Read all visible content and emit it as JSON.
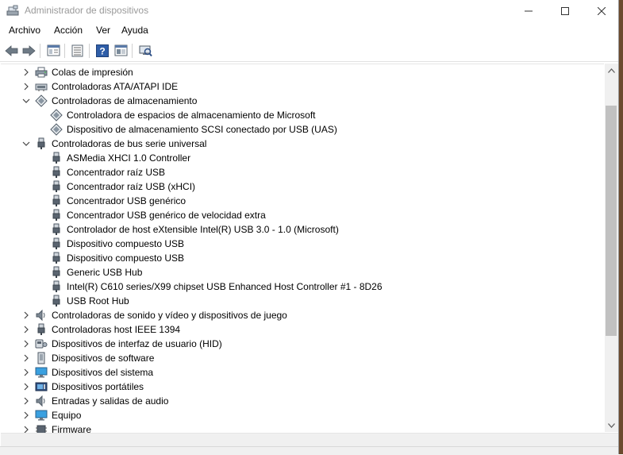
{
  "window": {
    "title": "Administrador de dispositivos"
  },
  "menu": [
    "Archivo",
    "Acción",
    "Ver",
    "Ayuda"
  ],
  "toolbar": [
    {
      "icon": "back-arrow-icon"
    },
    {
      "icon": "forward-arrow-icon"
    },
    {
      "icon": "properties-icon"
    },
    {
      "icon": "list-view-icon"
    },
    {
      "icon": "help-icon"
    },
    {
      "icon": "action-icon"
    },
    {
      "icon": "scan-hardware-icon"
    }
  ],
  "tree": [
    {
      "label": "Colas de impresión",
      "level": 0,
      "expander": "collapsed",
      "icon": "printer-icon"
    },
    {
      "label": "Controladoras ATA/ATAPI IDE",
      "level": 0,
      "expander": "collapsed",
      "icon": "ide-controller-icon"
    },
    {
      "label": "Controladoras de almacenamiento",
      "level": 0,
      "expander": "expanded",
      "icon": "storage-controller-icon"
    },
    {
      "label": "Controladora de espacios de almacenamiento de Microsoft",
      "level": 1,
      "expander": "none",
      "icon": "storage-controller-icon"
    },
    {
      "label": "Dispositivo de almacenamiento SCSI conectado por USB (UAS)",
      "level": 1,
      "expander": "none",
      "icon": "storage-controller-icon"
    },
    {
      "label": "Controladoras de bus serie universal",
      "level": 0,
      "expander": "expanded",
      "icon": "usb-plug-icon"
    },
    {
      "label": "ASMedia XHCI 1.0 Controller",
      "level": 1,
      "expander": "none",
      "icon": "usb-plug-icon"
    },
    {
      "label": "Concentrador raíz USB",
      "level": 1,
      "expander": "none",
      "icon": "usb-plug-icon"
    },
    {
      "label": "Concentrador raíz USB (xHCI)",
      "level": 1,
      "expander": "none",
      "icon": "usb-plug-icon"
    },
    {
      "label": "Concentrador USB genérico",
      "level": 1,
      "expander": "none",
      "icon": "usb-plug-icon"
    },
    {
      "label": "Concentrador USB genérico de velocidad extra",
      "level": 1,
      "expander": "none",
      "icon": "usb-plug-icon"
    },
    {
      "label": "Controlador de host eXtensible Intel(R) USB 3.0 - 1.0 (Microsoft)",
      "level": 1,
      "expander": "none",
      "icon": "usb-plug-icon"
    },
    {
      "label": "Dispositivo compuesto USB",
      "level": 1,
      "expander": "none",
      "icon": "usb-plug-icon"
    },
    {
      "label": "Dispositivo compuesto USB",
      "level": 1,
      "expander": "none",
      "icon": "usb-plug-icon"
    },
    {
      "label": "Generic USB Hub",
      "level": 1,
      "expander": "none",
      "icon": "usb-plug-icon"
    },
    {
      "label": "Intel(R) C610 series/X99 chipset USB Enhanced Host Controller #1 - 8D26",
      "level": 1,
      "expander": "none",
      "icon": "usb-plug-icon"
    },
    {
      "label": "USB Root Hub",
      "level": 1,
      "expander": "none",
      "icon": "usb-plug-icon"
    },
    {
      "label": "Controladoras de sonido y vídeo y dispositivos de juego",
      "level": 0,
      "expander": "collapsed",
      "icon": "speaker-icon"
    },
    {
      "label": "Controladoras host IEEE 1394",
      "level": 0,
      "expander": "collapsed",
      "icon": "usb-plug-icon"
    },
    {
      "label": "Dispositivos de interfaz de usuario (HID)",
      "level": 0,
      "expander": "collapsed",
      "icon": "hid-device-icon"
    },
    {
      "label": "Dispositivos de software",
      "level": 0,
      "expander": "collapsed",
      "icon": "software-device-icon"
    },
    {
      "label": "Dispositivos del sistema",
      "level": 0,
      "expander": "collapsed",
      "icon": "monitor-icon"
    },
    {
      "label": "Dispositivos portátiles",
      "level": 0,
      "expander": "collapsed",
      "icon": "portable-device-icon"
    },
    {
      "label": "Entradas y salidas de audio",
      "level": 0,
      "expander": "collapsed",
      "icon": "speaker-icon"
    },
    {
      "label": "Equipo",
      "level": 0,
      "expander": "collapsed",
      "icon": "monitor-icon"
    },
    {
      "label": "Firmware",
      "level": 0,
      "expander": "collapsed",
      "icon": "firmware-icon"
    }
  ]
}
